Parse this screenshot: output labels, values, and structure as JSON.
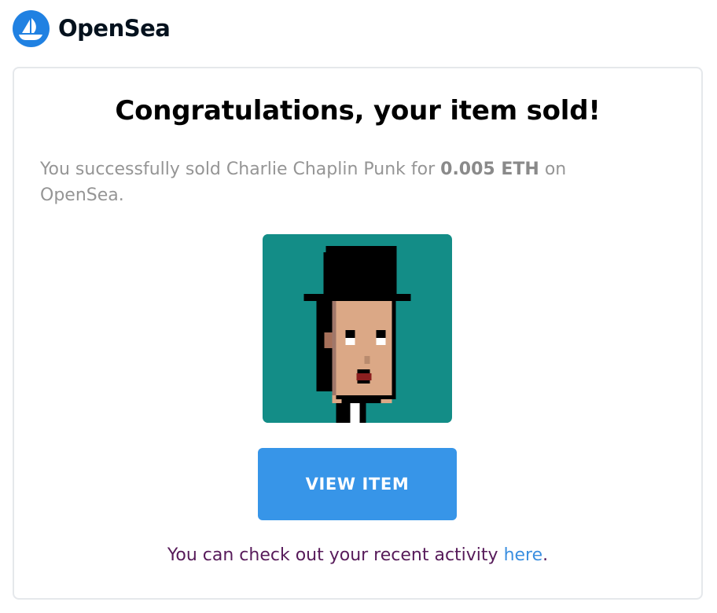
{
  "header": {
    "logo_icon": "opensea-boat-icon",
    "brand_name": "OpenSea",
    "brand_color": "#2081E2"
  },
  "email": {
    "title": "Congratulations, your item sold!",
    "message_prefix": "You successfully sold Charlie Chaplin Punk for ",
    "price": "0.005 ETH",
    "message_suffix": " on OpenSea.",
    "item_image": {
      "subject": "pixel-art punk with black bowler hat",
      "background_color": "#138d87"
    },
    "view_button_label": "VIEW ITEM",
    "view_button_color": "#3795e8",
    "footer_prefix": "You can check out your recent activity ",
    "footer_link": "here",
    "footer_suffix": "."
  }
}
